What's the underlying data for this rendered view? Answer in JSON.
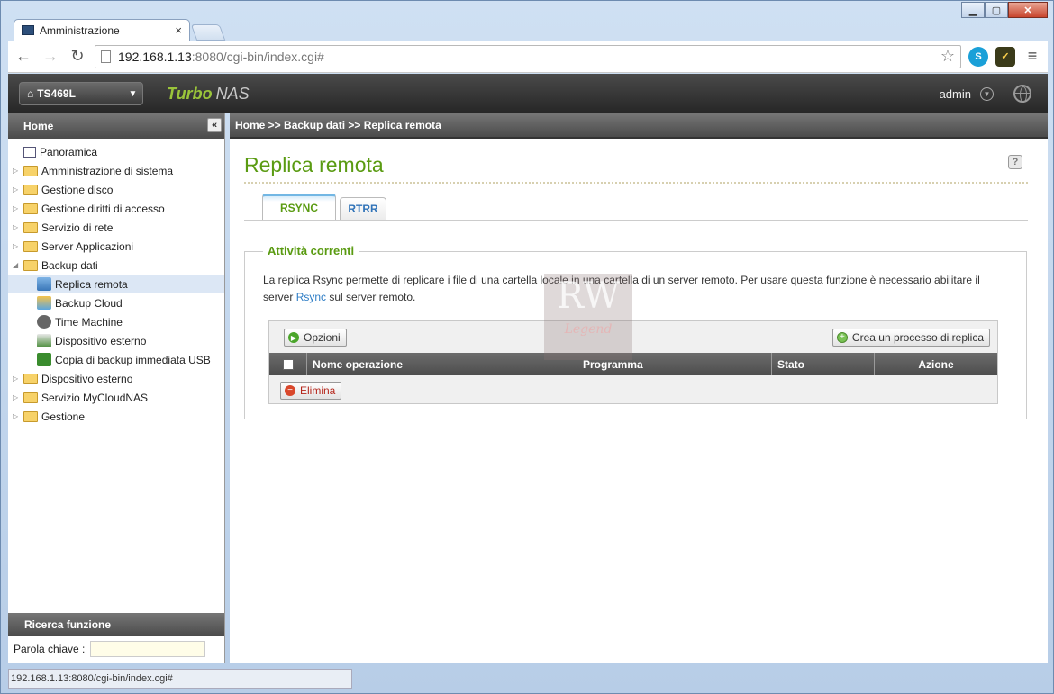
{
  "browser": {
    "tab_title": "Amministrazione",
    "tab_close": "×",
    "url_host": "192.168.1.13",
    "url_rest": ":8080/cgi-bin/index.cgi#",
    "status_url": "192.168.1.13:8080/cgi-bin/index.cgi#"
  },
  "header": {
    "model": "TS469L",
    "brand_bold": "Turbo",
    "brand_rest": "NAS",
    "user": "admin"
  },
  "sidebar": {
    "title": "Home",
    "items": [
      {
        "label": "Panoramica"
      },
      {
        "label": "Amministrazione di sistema"
      },
      {
        "label": "Gestione disco"
      },
      {
        "label": "Gestione diritti di accesso"
      },
      {
        "label": "Servizio di rete"
      },
      {
        "label": "Server Applicazioni"
      },
      {
        "label": "Backup dati"
      },
      {
        "label": "Replica remota"
      },
      {
        "label": "Backup Cloud"
      },
      {
        "label": "Time Machine"
      },
      {
        "label": "Dispositivo esterno"
      },
      {
        "label": "Copia di backup immediata USB"
      },
      {
        "label": "Dispositivo esterno"
      },
      {
        "label": "Servizio MyCloudNAS"
      },
      {
        "label": "Gestione"
      }
    ],
    "search_title": "Ricerca funzione",
    "search_label": "Parola chiave :"
  },
  "main": {
    "breadcrumb": "Home >> Backup dati >> Replica remota",
    "title": "Replica remota",
    "tabs": [
      {
        "label": "RSYNC"
      },
      {
        "label": "RTRR"
      }
    ],
    "section_title": "Attività correnti",
    "description_1": "La replica Rsync permette di replicare i file di una cartella locale in una cartella di un server remoto. Per usare questa funzione è necessario abilitare il server ",
    "description_link": "Rsync",
    "description_2": " sul server remoto.",
    "options_button": "Opzioni",
    "create_button": "Crea un processo di replica",
    "columns": [
      "Nome operazione",
      "Programma",
      "Stato",
      "Azione"
    ],
    "delete_button": "Elimina"
  },
  "watermark": {
    "top": "RW",
    "bottom": "Legend"
  }
}
